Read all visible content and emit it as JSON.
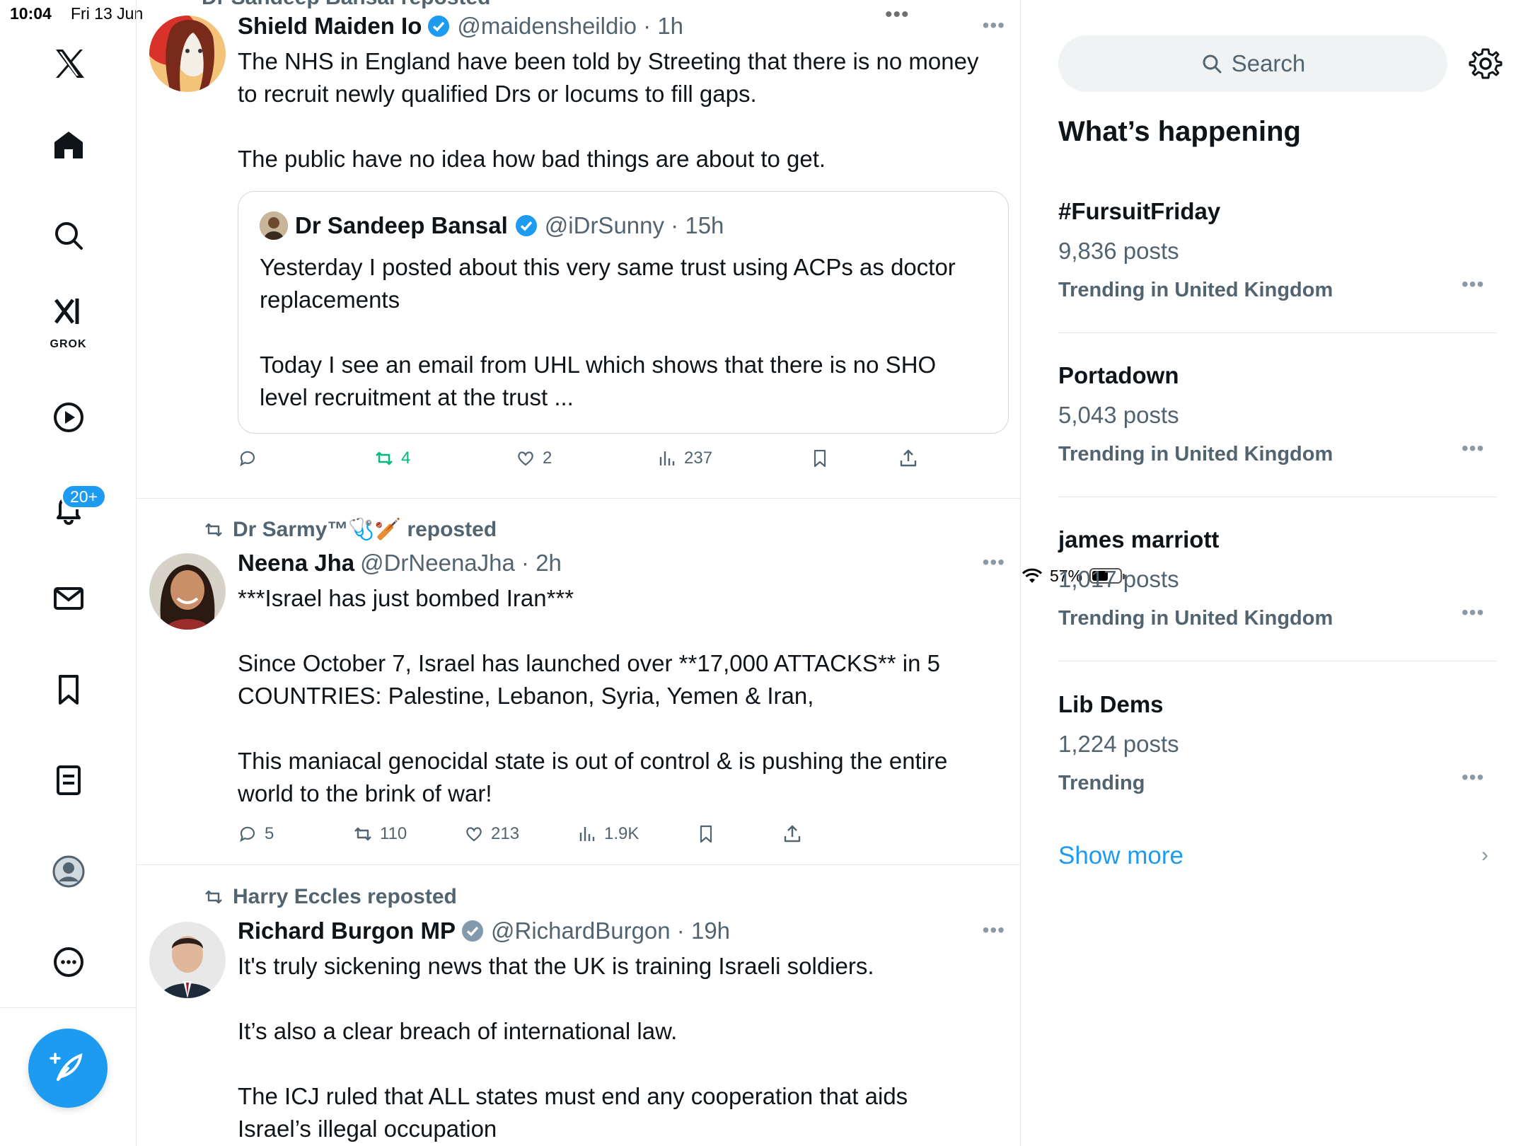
{
  "status_bar": {
    "time": "10:04",
    "date": "Fri 13 Jun",
    "battery": "57%",
    "battery_level": 0.57
  },
  "nav": {
    "grok_label": "GROK",
    "notifications_badge": "20+"
  },
  "top_repost_partial": "Dr Sandeep Bansal reposted",
  "posts": [
    {
      "name": "Shield Maiden Io",
      "handle": "@maidensheildio",
      "time": "1h",
      "text": "The NHS in England have been told by Streeting that there is no money\nto recruit newly qualified Drs or locums to fill gaps.\n\nThe public have no idea how bad things are about to get.",
      "quote": {
        "name": "Dr Sandeep Bansal",
        "handle": "@iDrSunny",
        "time": "15h",
        "text": "Yesterday I posted about this very same trust using ACPs as doctor\nreplacements\n\nToday I see an email from UHL which shows that there is no SHO\nlevel recruitment at the trust ..."
      },
      "actions": {
        "replies": "",
        "reposts": "4",
        "likes": "2",
        "views": "237"
      }
    },
    {
      "repost_by": "Dr Sarmy™🩺🏏 reposted",
      "name": "Neena Jha",
      "handle": "@DrNeenaJha",
      "time": "2h",
      "text": "***Israel has just bombed Iran***\n\nSince October 7, Israel has launched over **17,000 ATTACKS** in 5\nCOUNTRIES: Palestine, Lebanon, Syria, Yemen & Iran,\n\nThis maniacal genocidal state is out of control & is pushing the entire\nworld to the brink of war!",
      "actions": {
        "replies": "5",
        "reposts": "110",
        "likes": "213",
        "views": "1.9K"
      }
    },
    {
      "repost_by": "Harry Eccles reposted",
      "name": "Richard Burgon MP",
      "handle": "@RichardBurgon",
      "time": "19h",
      "text": "It's truly sickening news that the UK is training Israeli soldiers.\n\nIt’s also a clear breach of international law.\n\nThe ICJ ruled that ALL states must end any cooperation that aids\nIsrael’s illegal occupation"
    }
  ],
  "sidebar": {
    "search_placeholder": "Search",
    "title": "What’s happening",
    "trends": [
      {
        "name": "#FursuitFriday",
        "posts": "9,836 posts",
        "location": "Trending in United Kingdom"
      },
      {
        "name": "Portadown",
        "posts": "5,043 posts",
        "location": "Trending in United Kingdom"
      },
      {
        "name": "james marriott",
        "posts": "1,017 posts",
        "location": "Trending in United Kingdom"
      },
      {
        "name": "Lib Dems",
        "posts": "1,224 posts",
        "location": "Trending"
      }
    ],
    "show_more": "Show more"
  },
  "colors": {
    "accent": "#1d9bf0",
    "secondary_text": "#536471",
    "repost_green": "#00ba7c"
  }
}
